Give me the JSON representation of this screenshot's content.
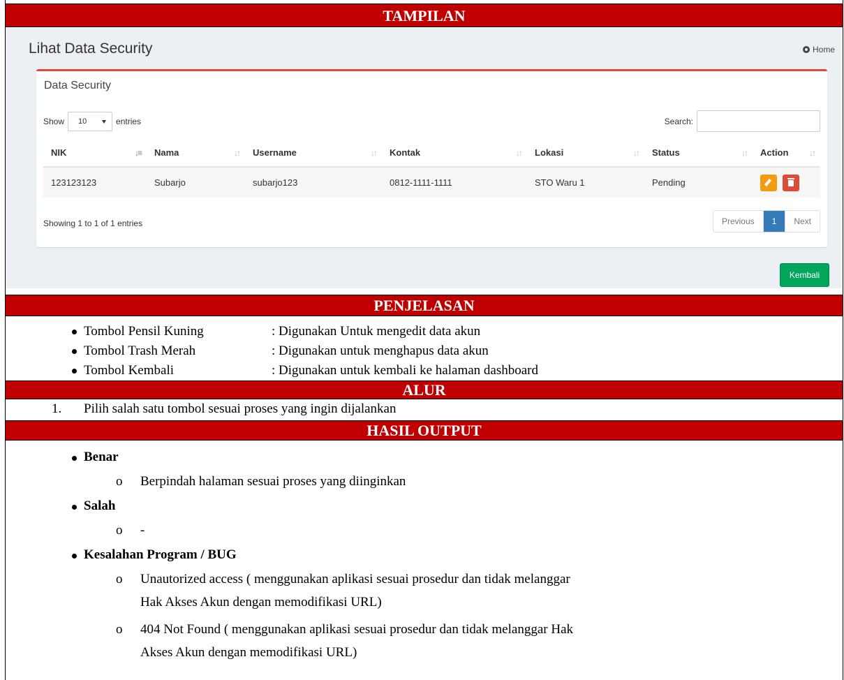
{
  "sections": {
    "tampilan": "TAMPILAN",
    "penjelasan": "PENJELASAN",
    "alur": "ALUR",
    "hasil": "HASIL OUTPUT"
  },
  "ui": {
    "page_title": "Lihat Data Security",
    "breadcrumb_home": "Home",
    "box_title": "Data Security",
    "show_label": "Show",
    "entries_value": "10",
    "entries_label": "entries",
    "search_label": "Search:",
    "columns": [
      "NIK",
      "Nama",
      "Username",
      "Kontak",
      "Lokasi",
      "Status",
      "Action"
    ],
    "rows": [
      [
        "123123123",
        "Subarjo",
        "subarjo123",
        "0812-1111-1111",
        "STO Waru 1",
        "Pending"
      ]
    ],
    "info": "Showing 1 to 1 of 1 entries",
    "pager": {
      "prev": "Previous",
      "page": "1",
      "next": "Next"
    },
    "back_button": "Kembali"
  },
  "penjelasan": [
    {
      "name": "Tombol Pensil Kuning",
      "desc": ": Digunakan Untuk mengedit data akun"
    },
    {
      "name": "Tombol Trash Merah",
      "desc": ": Digunakan untuk menghapus data akun"
    },
    {
      "name": "Tombol Kembali",
      "desc": ": Digunakan untuk kembali ke halaman dashboard"
    }
  ],
  "alur": {
    "num": "1.",
    "text": "Pilih salah satu tombol sesuai proses yang ingin dijalankan"
  },
  "hasil": {
    "benar": "Benar",
    "benar_item": "Berpindah halaman sesuai proses yang diinginkan",
    "salah": "Salah",
    "salah_item": "-",
    "bug": "Kesalahan Program / BUG",
    "bug_item1_l1": "Unautorized access ( menggunakan aplikasi sesuai prosedur dan tidak melanggar",
    "bug_item1_l2": "Hak Akses Akun dengan memodifikasi URL)",
    "bug_item2_l1": "404 Not Found ( menggunakan aplikasi sesuai prosedur dan tidak melanggar Hak",
    "bug_item2_l2": "Akses Akun dengan memodifikasi URL)"
  },
  "colors": {
    "section_bg": "#c00000",
    "box_accent": "#dd4b39",
    "edit": "#f39c12",
    "delete": "#dd4b39",
    "back": "#00a65a",
    "page_active": "#337ab7"
  }
}
